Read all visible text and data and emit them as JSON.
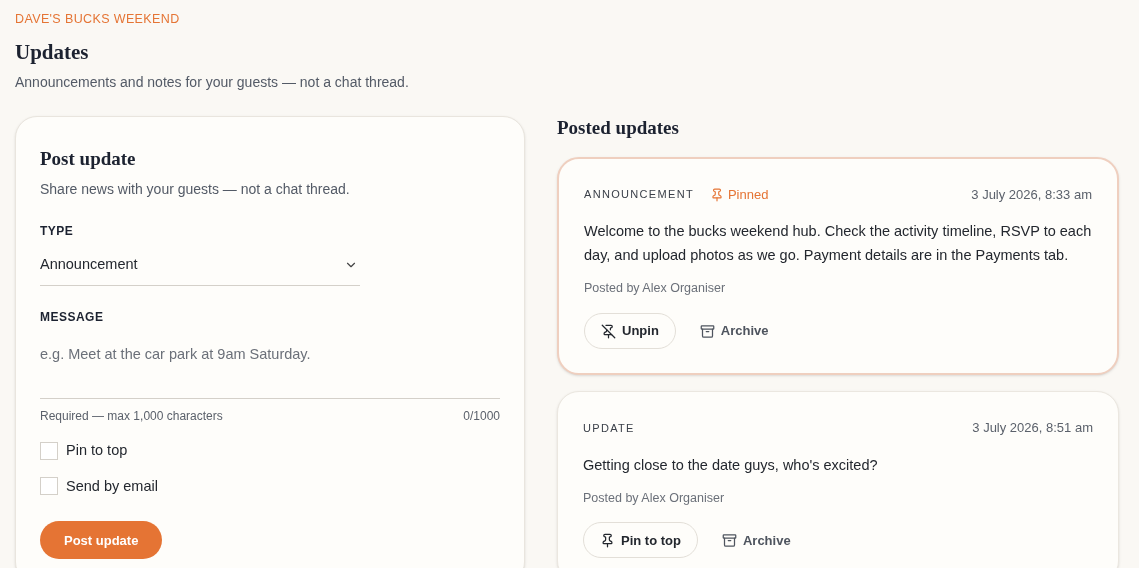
{
  "header": {
    "eyebrow": "DAVE'S BUCKS WEEKEND",
    "title": "Updates",
    "subtitle": "Announcements and notes for your guests — not a chat thread."
  },
  "form": {
    "title": "Post update",
    "subtitle": "Share news with your guests — not a chat thread.",
    "type_label": "TYPE",
    "type_value": "Announcement",
    "message_label": "MESSAGE",
    "message_placeholder": "e.g. Meet at the car park at 9am Saturday.",
    "hint": "Required — max 1,000 characters",
    "count": "0/1000",
    "options": [
      {
        "label": "Pin to top",
        "checked": false
      },
      {
        "label": "Send by email",
        "checked": false
      }
    ],
    "submit": "Post update"
  },
  "posted": {
    "title": "Posted updates",
    "posts": [
      {
        "type": "ANNOUNCEMENT",
        "pinned": true,
        "pinned_label": "Pinned",
        "time": "3 July 2026, 8:33 am",
        "body": "Welcome to the bucks weekend hub. Check the activity timeline, RSVP to each day, and upload photos as we go. Payment details are in the Payments tab.",
        "author": "Posted by Alex Organiser",
        "pin_action": "Unpin",
        "archive_action": "Archive"
      },
      {
        "type": "UPDATE",
        "pinned": false,
        "time": "3 July 2026, 8:51 am",
        "body": "Getting close to the date guys, who's excited?",
        "author": "Posted by Alex Organiser",
        "pin_action": "Pin to top",
        "archive_action": "Archive"
      }
    ]
  }
}
